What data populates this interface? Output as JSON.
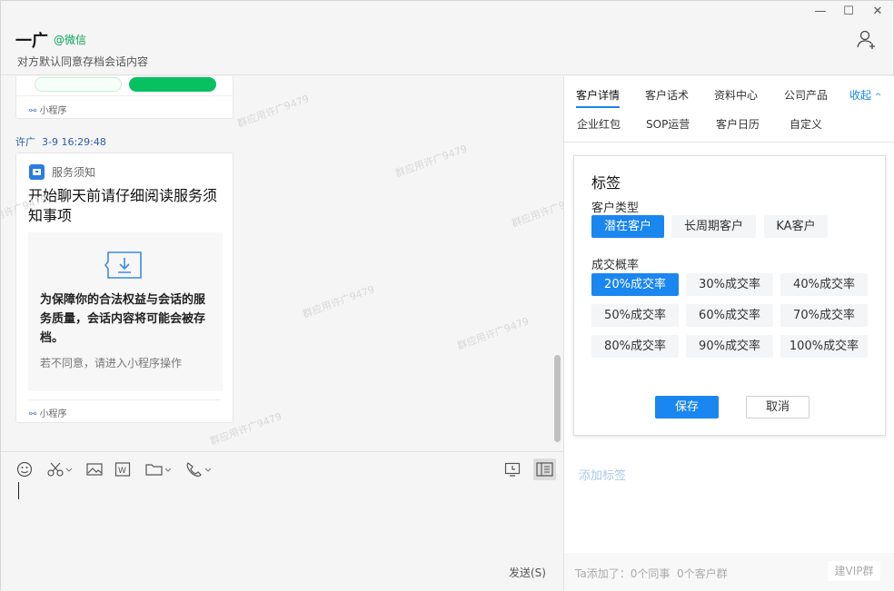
{
  "window": {
    "minimize": "—",
    "maximize": "☐",
    "close": "✕"
  },
  "header": {
    "name": "一广",
    "wechat_tag": "@微信",
    "subtitle": "对方默认同意存档会话内容"
  },
  "chat": {
    "prev_card_footer": "小程序",
    "watermark": "群应用许广9479",
    "msg": {
      "sender": "许广",
      "time": "3-9 16:29:48"
    },
    "notice": {
      "header": "服务须知",
      "title": "开始聊天前请仔细阅读服务须知事项",
      "body": "为保障你的合法权益与会话的服务质量，会话内容将可能会被存档。",
      "hint": "若不同意，请进入小程序操作",
      "footer": "小程序"
    }
  },
  "composer": {
    "send": "发送(S)"
  },
  "sidebar": {
    "tabs_row1": [
      "客户详情",
      "客户话术",
      "资料中心",
      "公司产品"
    ],
    "collapse": "收起",
    "tabs_row2": [
      "企业红包",
      "SOP运营",
      "客户日历",
      "自定义"
    ],
    "panel": {
      "title": "标签",
      "group1": {
        "label": "客户类型",
        "chips": [
          "潜在客户",
          "长周期客户",
          "KA客户"
        ],
        "selected": "潜在客户"
      },
      "group2": {
        "label": "成交概率",
        "chips": [
          "20%成交率",
          "30%成交率",
          "40%成交率",
          "50%成交率",
          "60%成交率",
          "70%成交率",
          "80%成交率",
          "90%成交率",
          "100%成交率"
        ],
        "selected": "20%成交率"
      },
      "save": "保存",
      "cancel": "取消"
    },
    "add_tag": "添加标签",
    "footer": {
      "added": "Ta添加了：",
      "colleagues": "0个同事",
      "groups": "0个客户群",
      "vip": "建VIP群"
    }
  },
  "colors": {
    "accent": "#1a86ef",
    "wechat_green": "#07a35a"
  }
}
